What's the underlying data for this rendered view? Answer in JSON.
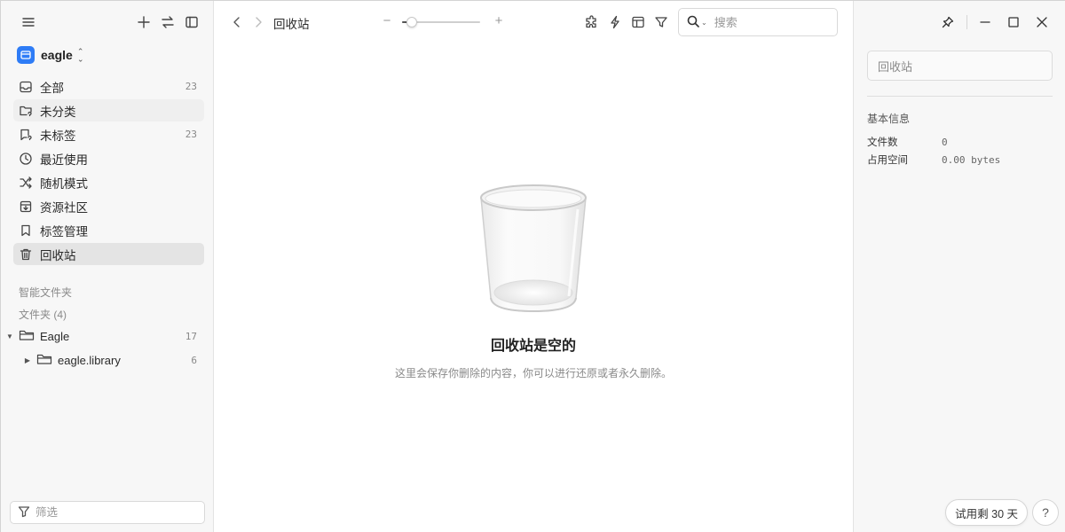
{
  "sidebar": {
    "library_name": "eagle",
    "items": [
      {
        "label": "全部",
        "count": "23",
        "icon": "inbox-icon"
      },
      {
        "label": "未分类",
        "count": "",
        "icon": "folder-question-icon"
      },
      {
        "label": "未标签",
        "count": "23",
        "icon": "tag-question-icon"
      },
      {
        "label": "最近使用",
        "count": "",
        "icon": "clock-icon"
      },
      {
        "label": "随机模式",
        "count": "",
        "icon": "shuffle-icon"
      },
      {
        "label": "资源社区",
        "count": "",
        "icon": "download-box-icon"
      },
      {
        "label": "标签管理",
        "count": "",
        "icon": "bookmark-icon"
      },
      {
        "label": "回收站",
        "count": "",
        "icon": "trash-icon"
      }
    ],
    "active_item": "回收站",
    "smart_folders_label": "智能文件夹",
    "folders_label": "文件夹 (4)",
    "folders": [
      {
        "label": "Eagle",
        "count": "17"
      },
      {
        "label": "eagle.library",
        "count": "6"
      }
    ],
    "filter_placeholder": "筛选"
  },
  "toolbar": {
    "breadcrumb": "回收站",
    "zoom_minus": "−",
    "zoom_plus": "+",
    "zoom_level": 0.12,
    "search_placeholder": "搜索"
  },
  "empty_state": {
    "title": "回收站是空的",
    "description": "这里会保存你删除的内容，你可以进行还原或者永久删除。"
  },
  "inspector": {
    "name_value": "回收站",
    "section_title": "基本信息",
    "rows": [
      {
        "key": "文件数",
        "value": "0"
      },
      {
        "key": "占用空间",
        "value": "0.00 bytes"
      }
    ],
    "trial_label": "试用剩 30 天",
    "help_label": "?"
  },
  "colors": {
    "accent": "#2e7cf6",
    "sidebar_bg": "#f7f7f7",
    "active_item_bg": "#e4e4e4"
  }
}
